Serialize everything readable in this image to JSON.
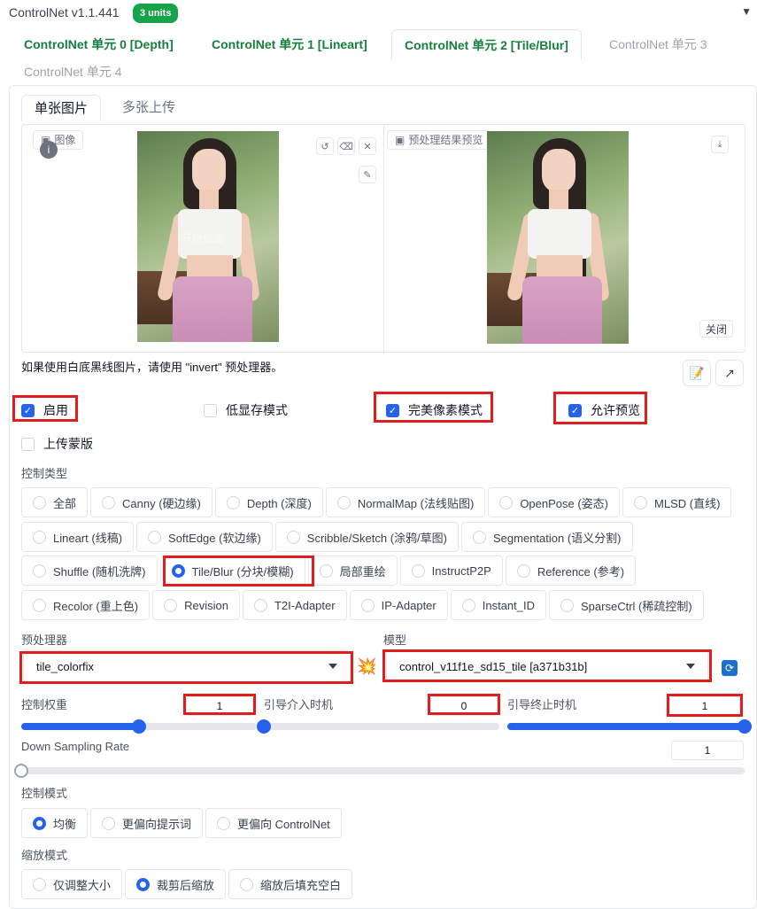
{
  "header": {
    "title": "ControlNet v1.1.441",
    "units_badge": "3 units"
  },
  "tabs": [
    {
      "label": "ControlNet 单元 0 [Depth]"
    },
    {
      "label": "ControlNet 单元 1 [Lineart]"
    },
    {
      "label": "ControlNet 单元 2 [Tile/Blur]"
    },
    {
      "label": "ControlNet 单元 3"
    },
    {
      "label": "ControlNet 单元 4"
    }
  ],
  "subtabs": {
    "single": "单张图片",
    "batch": "多张上传"
  },
  "image_panel": {
    "input_label": "图像",
    "preview_label": "预处理结果预览",
    "watermark": "开始绘画",
    "close_label": "关闭"
  },
  "invert_note": "如果使用白底黑线图片，请使用 \"invert\" 预处理器。",
  "options": {
    "enable": {
      "label": "启用",
      "checked": true
    },
    "low_vram": {
      "label": "低显存模式",
      "checked": false
    },
    "pixel_perfect": {
      "label": "完美像素模式",
      "checked": true
    },
    "allow_preview": {
      "label": "允许预览",
      "checked": true
    },
    "upload_mask": {
      "label": "上传蒙版",
      "checked": false
    }
  },
  "control_type": {
    "label": "控制类型",
    "rows": [
      [
        "全部",
        "Canny (硬边缘)",
        "Depth (深度)",
        "NormalMap (法线贴图)",
        "OpenPose (姿态)",
        "MLSD (直线)"
      ],
      [
        "Lineart (线稿)",
        "SoftEdge (软边缘)",
        "Scribble/Sketch (涂鸦/草图)",
        "Segmentation (语义分割)"
      ],
      [
        "Shuffle (随机洗牌)",
        "Tile/Blur (分块/模糊)",
        "局部重绘",
        "InstructP2P",
        "Reference (参考)"
      ],
      [
        "Recolor (重上色)",
        "Revision",
        "T2I-Adapter",
        "IP-Adapter",
        "Instant_ID",
        "SparseCtrl (稀疏控制)"
      ]
    ],
    "selected": "Tile/Blur (分块/模糊)"
  },
  "preprocessor": {
    "label": "预处理器",
    "value": "tile_colorfix"
  },
  "model": {
    "label": "模型",
    "value": "control_v11f1e_sd15_tile [a371b31b]"
  },
  "sliders": {
    "weight": {
      "label": "控制权重",
      "value": "1",
      "fraction": 0.5
    },
    "start": {
      "label": "引导介入时机",
      "value": "0",
      "fraction": 0.0
    },
    "end": {
      "label": "引导终止时机",
      "value": "1",
      "fraction": 1.0
    },
    "down_sampling": {
      "label": "Down Sampling Rate",
      "value": "1",
      "fraction": 0.0
    }
  },
  "control_mode": {
    "label": "控制模式",
    "options": [
      "均衡",
      "更偏向提示词",
      "更偏向 ControlNet"
    ],
    "selected": "均衡"
  },
  "resize_mode": {
    "label": "缩放模式",
    "options": [
      "仅调整大小",
      "裁剪后缩放",
      "缩放后填充空白"
    ],
    "selected": "裁剪后缩放"
  },
  "colors": {
    "accent": "#2563eb",
    "badge": "#16a34a",
    "tab_green": "#15803d",
    "highlight": "#e11d1d"
  }
}
